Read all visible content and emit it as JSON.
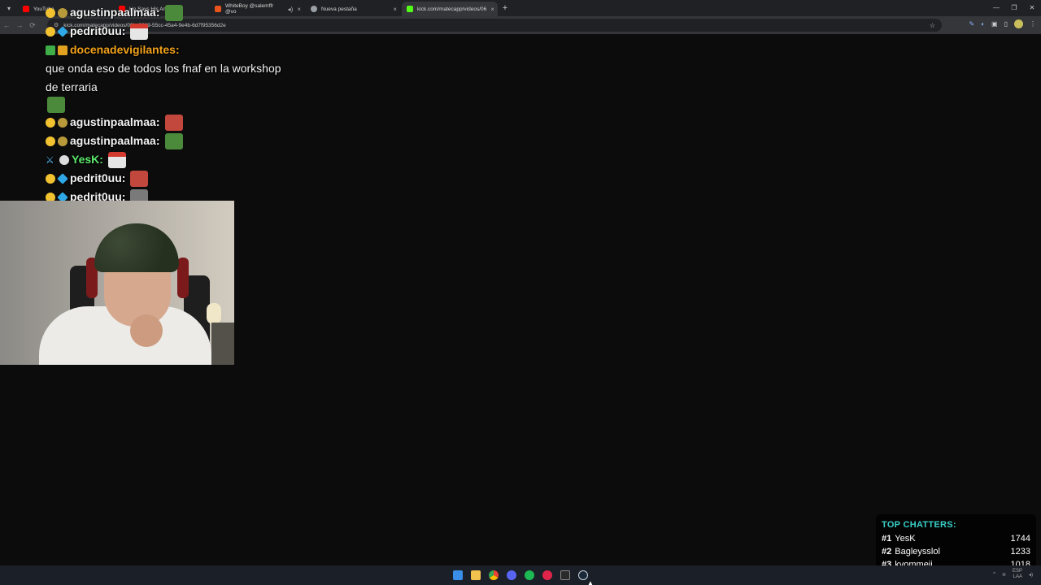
{
  "browser": {
    "tabs": [
      {
        "label": "YouTube",
        "color": "#ff0000",
        "active": false
      },
      {
        "label": "He Says His Amish",
        "color": "#ff0000",
        "active": false
      },
      {
        "label": "WhiteBoy @salemffr @vo",
        "color": "#e8541d",
        "active": false
      },
      {
        "label": "Nueva pestaña",
        "color": "#9aa0a6",
        "active": false
      },
      {
        "label": "kick.com/matecapp/videos/06",
        "color": "#53fc18",
        "active": true
      }
    ],
    "url": "kick.com/matecapp/videos/06bc9969-55cc-45a4-9e4b-6d7f95356d2e"
  },
  "chat": {
    "messages": [
      {
        "user": "agustinpaalmaa",
        "user_color": "#f2f2f2",
        "badges": [
          "gold",
          "coin"
        ],
        "text": "",
        "emote": "frog"
      },
      {
        "user": "pedrit0uu",
        "user_color": "#f2f2f2",
        "badges": [
          "gold",
          "cube"
        ],
        "text": "",
        "emote": "santa"
      },
      {
        "user": "docenadevigilantes",
        "user_color": "#f2a21b",
        "badges": [
          "green",
          "box"
        ],
        "text": "que onda eso de todos los fnaf en la workshop de terraria",
        "emote": "frog"
      },
      {
        "user": "agustinpaalmaa",
        "user_color": "#f2f2f2",
        "badges": [
          "gold",
          "coin"
        ],
        "text": "",
        "emote": "red"
      },
      {
        "user": "agustinpaalmaa",
        "user_color": "#f2f2f2",
        "badges": [
          "gold",
          "coin"
        ],
        "text": "",
        "emote": "frog"
      },
      {
        "user": "YesK",
        "user_color": "#5be86c",
        "badges": [
          "sword",
          "hand"
        ],
        "text": "",
        "emote": "santa"
      },
      {
        "user": "pedrit0uu",
        "user_color": "#f2f2f2",
        "badges": [
          "gold",
          "cube"
        ],
        "text": "",
        "emote": "red"
      },
      {
        "user": "pedrit0uu",
        "user_color": "#f2f2f2",
        "badges": [
          "gold",
          "cube"
        ],
        "text": "",
        "emote": "grey"
      }
    ]
  },
  "top_chatters": {
    "title": "TOP CHATTERS:",
    "title_color": "#39d0c8",
    "rows": [
      {
        "rank": "#1",
        "name": "YesK",
        "count": "1744"
      },
      {
        "rank": "#2",
        "name": "Bagleysslol",
        "count": "1233"
      },
      {
        "rank": "#3",
        "name": "kyommeii",
        "count": "1018"
      }
    ]
  },
  "taskbar": {
    "icons": [
      "windows-start-icon",
      "file-explorer-icon",
      "chrome-icon",
      "discord-icon",
      "spotify-icon",
      "opera-gx-icon",
      "epic-games-icon",
      "steam-icon"
    ],
    "tray_lang": "ESP",
    "tray_lang2": "LAA"
  }
}
